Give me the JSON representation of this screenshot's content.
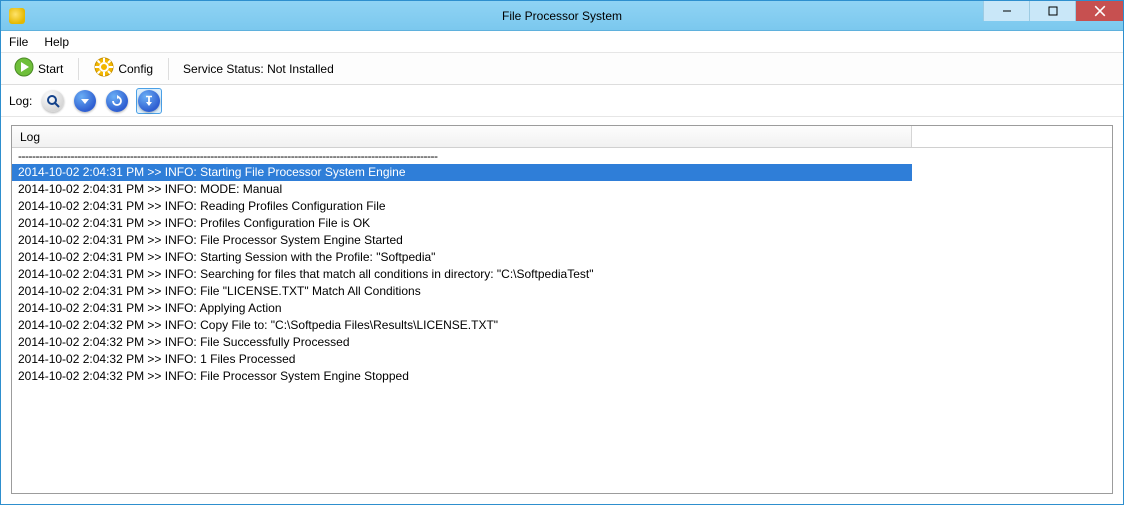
{
  "window": {
    "title": "File Processor System"
  },
  "menu": {
    "file": "File",
    "help": "Help"
  },
  "toolbar": {
    "start": "Start",
    "config": "Config",
    "status": "Service Status: Not Installed"
  },
  "logbar": {
    "label": "Log:"
  },
  "log": {
    "column": "Log",
    "dashline": "------------------------------------------------------------------------------------------------------------------------",
    "entries": [
      "2014-10-02 2:04:31 PM >> INFO: Starting File Processor System Engine",
      "2014-10-02 2:04:31 PM >> INFO: MODE: Manual",
      "2014-10-02 2:04:31 PM >> INFO: Reading Profiles Configuration File",
      "2014-10-02 2:04:31 PM >> INFO: Profiles Configuration File is OK",
      "2014-10-02 2:04:31 PM >> INFO: File Processor System Engine Started",
      "2014-10-02 2:04:31 PM >> INFO: Starting Session with the Profile: \"Softpedia\"",
      "2014-10-02 2:04:31 PM >> INFO: Searching for files that match all conditions in directory: \"C:\\SoftpediaTest\"",
      "2014-10-02 2:04:31 PM >> INFO: File \"LICENSE.TXT\" Match All Conditions",
      "2014-10-02 2:04:31 PM >> INFO: Applying Action",
      "2014-10-02 2:04:32 PM >> INFO: Copy File to: \"C:\\Softpedia Files\\Results\\LICENSE.TXT\"",
      "2014-10-02 2:04:32 PM >> INFO: File Successfully Processed",
      "2014-10-02 2:04:32 PM >> INFO: 1 Files Processed",
      "2014-10-02 2:04:32 PM >> INFO: File Processor System Engine Stopped"
    ],
    "selected_index": 0
  }
}
